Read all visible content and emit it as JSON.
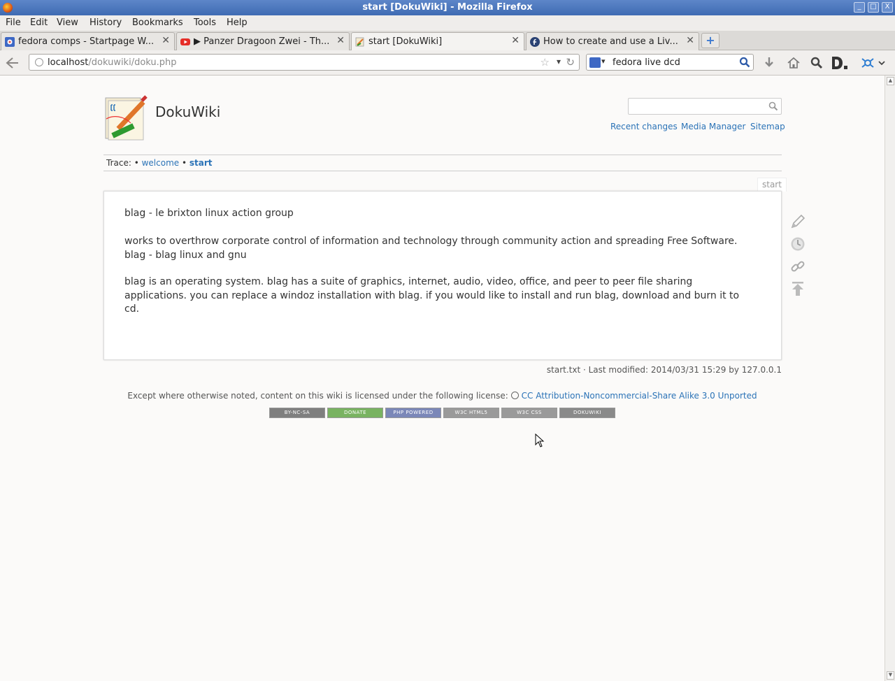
{
  "window": {
    "title": "start [DokuWiki] - Mozilla Firefox",
    "buttons": [
      "_",
      "□",
      "X"
    ]
  },
  "menu": [
    "File",
    "Edit",
    "View",
    "History",
    "Bookmarks",
    "Tools",
    "Help"
  ],
  "tabs": [
    {
      "label": "fedora comps - Startpage W...",
      "icon": "startpage-icon"
    },
    {
      "label": "▶ Panzer Dragoon Zwei - Th...",
      "icon": "youtube-icon"
    },
    {
      "label": "start [DokuWiki]",
      "icon": "dokuwiki-icon",
      "active": true
    },
    {
      "label": "How to create and use a Liv...",
      "icon": "fedora-icon"
    }
  ],
  "tab_close": "✕",
  "newtab": "+",
  "url": {
    "host": "localhost",
    "path": "/dokuwiki/doku.php"
  },
  "search": {
    "value": "fedora live dcd"
  },
  "wiki": {
    "sitename": "DokuWiki",
    "tools": [
      "Recent changes",
      "Media Manager",
      "Sitemap"
    ],
    "trace_label": "Trace:",
    "trace": [
      "welcome",
      "start"
    ],
    "pageid": "start",
    "paragraphs": [
      "blag - le brixton linux action group",
      "works to overthrow corporate control of information and technology through community action and spreading Free Software. blag - blag linux and gnu",
      "blag is an operating system. blag has a suite of graphics, internet, audio, video, office, and peer to peer file sharing applications. you can replace a windoz installation with blag. if you would like to install and run blag, download and burn it to cd."
    ],
    "docinfo": "start.txt · Last modified: 2014/03/31 15:29 by 127.0.0.1",
    "license_text": "Except where otherwise noted, content on this wiki is licensed under the following license:",
    "license_link": "CC Attribution-Noncommercial-Share Alike 3.0 Unported",
    "badges": [
      "BY-NC-SA",
      "DONATE",
      "PHP POWERED",
      "W3C HTML5",
      "W3C CSS",
      "DOKUWIKI"
    ]
  },
  "colors": {
    "link": "#2b73b7",
    "titlebar": "#4a76bd"
  }
}
